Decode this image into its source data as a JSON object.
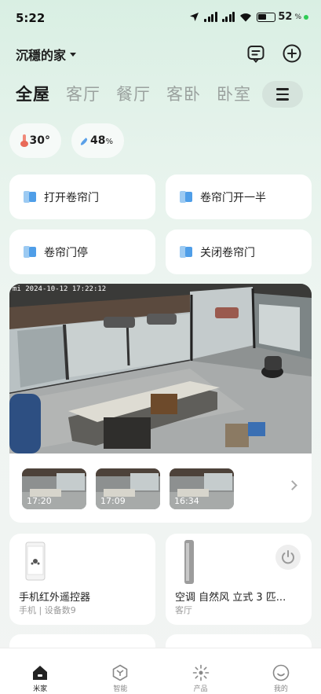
{
  "status": {
    "time": "5:22",
    "battery": "52",
    "battery_unit": "%"
  },
  "header": {
    "home_name": "沉穩的家"
  },
  "tabs": [
    {
      "label": "全屋",
      "active": true
    },
    {
      "label": "客厅",
      "active": false
    },
    {
      "label": "餐厅",
      "active": false
    },
    {
      "label": "客卧",
      "active": false
    },
    {
      "label": "卧室",
      "active": false
    }
  ],
  "environment": {
    "temperature": "30°",
    "humidity": "48",
    "humidity_unit": "%"
  },
  "scenes": [
    {
      "label": "打开卷帘门"
    },
    {
      "label": "卷帘门开一半"
    },
    {
      "label": "卷帘门停"
    },
    {
      "label": "关闭卷帘门"
    }
  ],
  "camera": {
    "brand": "mi",
    "timestamp": "2024-10-12 17:22:12",
    "clips": [
      {
        "time": "17:20"
      },
      {
        "time": "17:09"
      },
      {
        "time": "16:34"
      }
    ]
  },
  "devices": [
    {
      "name": "手机红外遥控器",
      "sub": "手机 | 设备数9"
    },
    {
      "name": "空调 自然风 立式 3 匹...",
      "sub": "客厅"
    }
  ],
  "nav": [
    {
      "label": "米家",
      "icon": "home-icon",
      "active": true
    },
    {
      "label": "智能",
      "icon": "smart-icon",
      "active": false
    },
    {
      "label": "产品",
      "icon": "product-icon",
      "active": false
    },
    {
      "label": "我的",
      "icon": "profile-icon",
      "active": false
    }
  ],
  "colors": {
    "accent_green": "#2ecc55",
    "background": "#eef5f1"
  }
}
